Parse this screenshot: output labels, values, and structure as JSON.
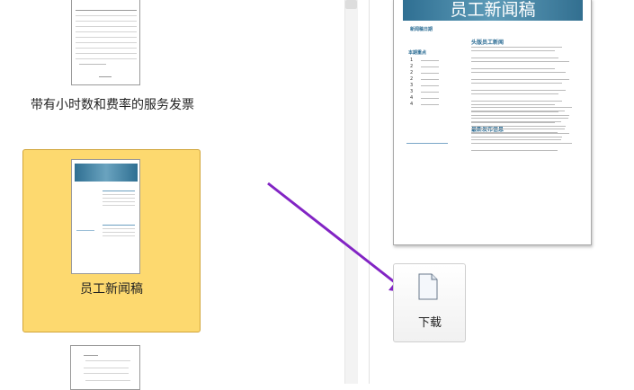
{
  "templates": [
    {
      "label": "带有小时数和费率的服务发票",
      "selected": false
    },
    {
      "label": "员工新闻稿",
      "selected": true
    },
    {
      "label": "",
      "selected": false
    }
  ],
  "preview": {
    "banner_title": "员工新闻稿",
    "issue_label": "新闻稿日期",
    "toc_title": "本期重点",
    "toc_numbers": [
      "1",
      "2",
      "2",
      "2",
      "3",
      "3",
      "4",
      "4"
    ],
    "headline1": "头版员工新闻",
    "headline2": "最新发布信息"
  },
  "download": {
    "label": "下载",
    "icon": "document-icon"
  },
  "colors": {
    "selected": "#fdd96f",
    "arrow": "#8224c4",
    "accent": "#2b6c94"
  }
}
